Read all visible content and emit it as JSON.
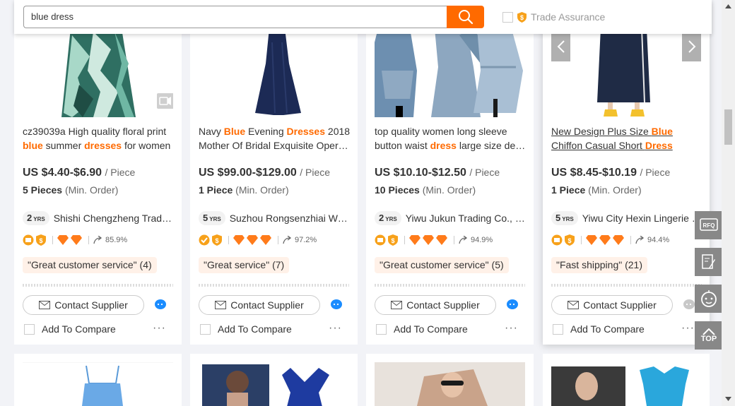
{
  "search": {
    "value": "blue dress",
    "trade_assurance_label": "Trade Assurance"
  },
  "products": [
    {
      "title_parts": [
        "cz39039a High quality floral print ",
        "blue",
        " summer ",
        "dresses",
        " for women"
      ],
      "price": "US $4.40-$6.90",
      "unit": "/ Piece",
      "moq_qty": "5 Pieces",
      "moq_label": "(Min. Order)",
      "years": "2",
      "yrs_label": "YRS",
      "supplier": "Shishi Chengzheng Trading Co., Ltd.",
      "response_rate": "85.9%",
      "tag": "\"Great customer service\" (4)",
      "contact_label": "Contact Supplier",
      "compare_label": "Add To Compare",
      "more": "···"
    },
    {
      "title_parts": [
        "Navy ",
        "Blue",
        " Evening ",
        "Dresses",
        " 2018",
        "Mother Of Bridal Exquisite Operate Dresses"
      ],
      "price": "US $99.00-$129.00",
      "unit": "/ Piece",
      "moq_qty": "1 Piece",
      "moq_label": "(Min. Order)",
      "years": "5",
      "yrs_label": "YRS",
      "supplier": "Suzhou Rongsenzhiai Wedding Dresses",
      "response_rate": "97.2%",
      "tag": "\"Great service\" (7)",
      "contact_label": "Contact Supplier",
      "compare_label": "Add To Compare",
      "more": "···"
    },
    {
      "title_parts": [
        "top quality women long sleeve ",
        "button waist ",
        "dress",
        " large size denim"
      ],
      "price": "US $10.10-$12.50",
      "unit": "/ Piece",
      "moq_qty": "10 Pieces",
      "moq_label": "(Min. Order)",
      "years": "2",
      "yrs_label": "YRS",
      "supplier": "Yiwu Jukun Trading Co., Ltd.",
      "response_rate": "94.9%",
      "tag": "\"Great customer service\" (5)",
      "contact_label": "Contact Supplier",
      "compare_label": "Add To Compare",
      "more": "···"
    },
    {
      "title_parts": [
        "New Design Plus Size ",
        "Blue",
        "Chiffon Casual Short ",
        "Dress"
      ],
      "price": "US $8.45-$10.19",
      "unit": "/ Piece",
      "moq_qty": "1 Piece",
      "moq_label": "(Min. Order)",
      "years": "5",
      "yrs_label": "YRS",
      "supplier": "Yiwu City Hexin Lingerie Co., Ltd.",
      "response_rate": "94.4%",
      "tag": "\"Fast shipping\" (21)",
      "contact_label": "Contact Supplier",
      "compare_label": "Add To Compare",
      "more": "···"
    }
  ],
  "rail": {
    "rfq_label": "RFQ",
    "top_label": "TOP"
  },
  "colors": {
    "accent": "#ff6a00",
    "rail": "#888888",
    "chat_blue": "#1a8cff"
  }
}
